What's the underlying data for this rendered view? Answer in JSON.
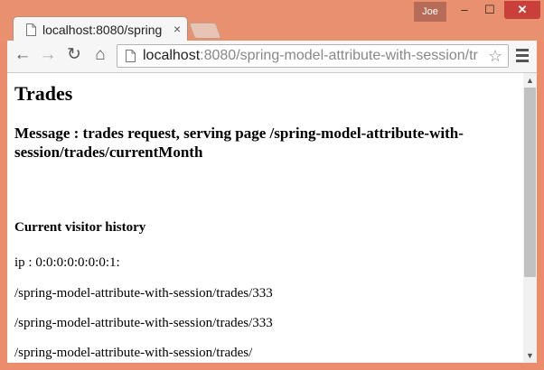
{
  "browser": {
    "tab_title": "localhost:8080/spring",
    "tab_close": "×",
    "profile_name": "Joe",
    "window_controls": {
      "minimize": "–",
      "maximize": "☐",
      "close": "✕"
    },
    "nav": {
      "back": "←",
      "forward": "→",
      "reload": "↻",
      "home": "⌂"
    },
    "url_host": "localhost",
    "url_rest": ":8080/spring-model-attribute-with-session/tr",
    "star": "☆",
    "icons": [
      "page-icon",
      "back-arrow-icon",
      "forward-arrow-icon",
      "reload-icon",
      "home-icon",
      "star-icon",
      "menu-icon"
    ]
  },
  "page": {
    "title": "Trades",
    "message": "Message : trades request, serving page /spring-model-attribute-with-session/trades/currentMonth",
    "history_heading": "Current visitor history",
    "history": [
      "ip : 0:0:0:0:0:0:0:1:",
      "/spring-model-attribute-with-session/trades/333",
      "/spring-model-attribute-with-session/trades/333",
      "/spring-model-attribute-with-session/trades/"
    ]
  },
  "scrollbar": {
    "up": "▲",
    "down": "▼",
    "position": 0
  },
  "colors": {
    "frame": "#eb8d6c",
    "close_button": "#c9403a",
    "tab": "#f6f6f6"
  }
}
